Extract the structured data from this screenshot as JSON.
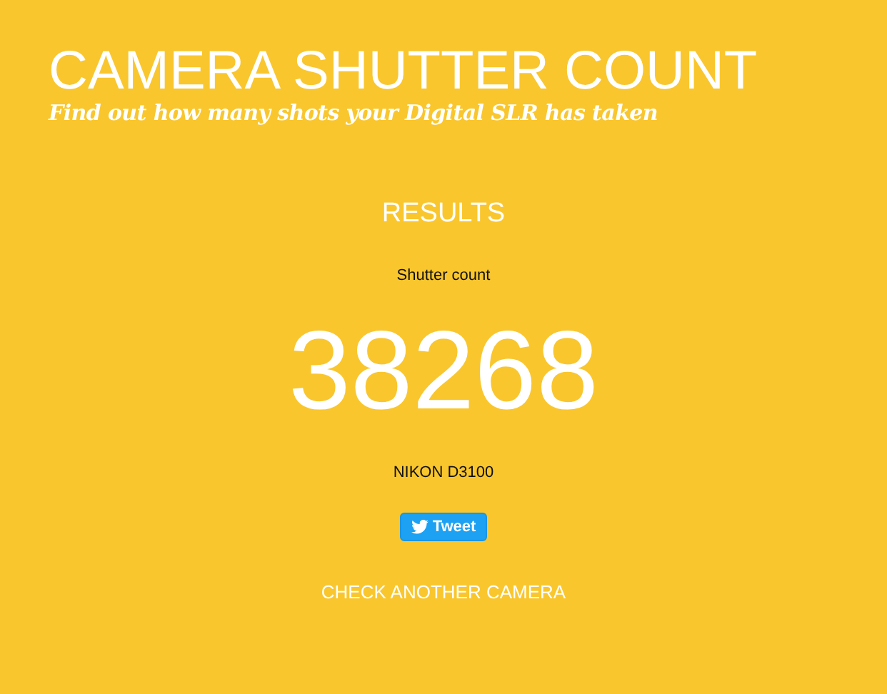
{
  "header": {
    "title": "CAMERA SHUTTER COUNT",
    "subtitle": "Find out how many shots your Digital SLR has taken"
  },
  "results": {
    "heading": "RESULTS",
    "label": "Shutter count",
    "count": "38268",
    "camera": "NIKON D3100",
    "tweet_button": "Tweet",
    "link": "CHECK ANOTHER CAMERA"
  }
}
